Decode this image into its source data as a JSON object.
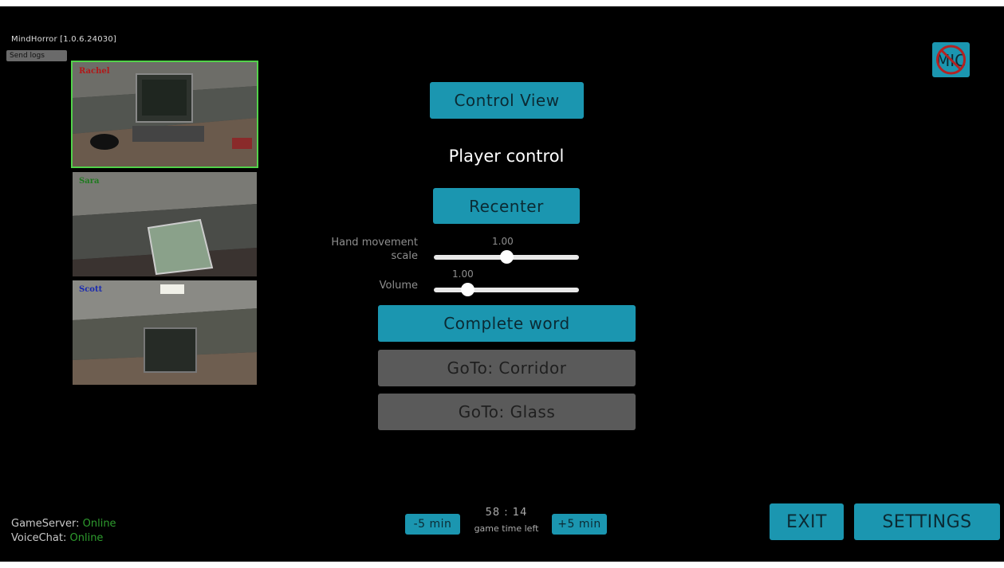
{
  "header": {
    "version": "MindHorror [1.0.6.24030]",
    "send_logs": "Send logs"
  },
  "cameras": [
    {
      "name": "Rachel",
      "name_color": "#b01a1a",
      "selected": true
    },
    {
      "name": "Sara",
      "name_color": "#1f7a1f",
      "selected": false
    },
    {
      "name": "Scott",
      "name_color": "#1a2ab0",
      "selected": false
    }
  ],
  "control": {
    "control_view": "Control View",
    "player_control": "Player control",
    "recenter": "Recenter",
    "hand_label": "Hand movement scale",
    "hand_label_1": "Hand movement",
    "hand_label_2": "scale",
    "hand_value": "1.00",
    "hand_level": 0.5,
    "volume_label": "Volume",
    "volume_value": "1.00",
    "volume_level": 0.23,
    "complete_word": "Complete word",
    "goto_corridor": "GoTo: Corridor",
    "goto_glass": "GoTo: Glass"
  },
  "status": {
    "gameserver_label": "GameServer:",
    "gameserver_value": "Online",
    "voicechat_label": "VoiceChat:",
    "voicechat_value": "Online"
  },
  "timer": {
    "minus": "-5 min",
    "plus": "+5 min",
    "time": "58 : 14",
    "caption": "game time left"
  },
  "footer": {
    "exit": "EXIT",
    "settings": "SETTINGS"
  },
  "mic": {
    "label": "MIC",
    "muted": true
  },
  "colors": {
    "accent": "#1b96b0",
    "online": "#2e9c2e",
    "selected_outline": "#52d24a"
  }
}
